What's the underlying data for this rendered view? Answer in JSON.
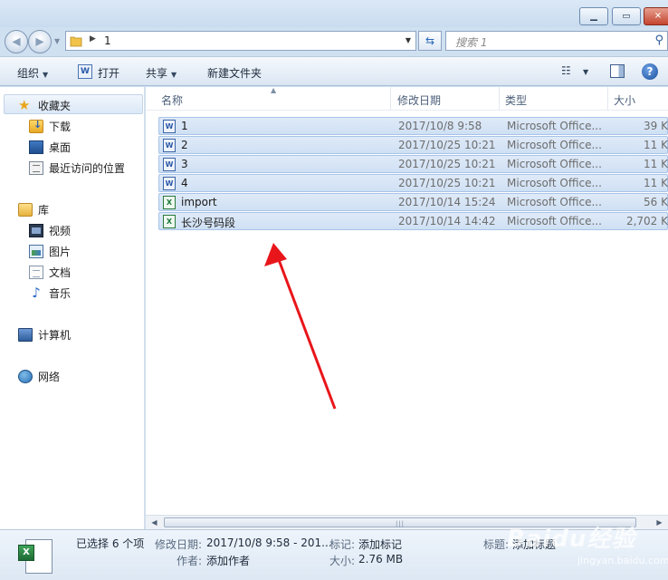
{
  "address": {
    "crumb": "1"
  },
  "search": {
    "placeholder": "搜索 1"
  },
  "toolbar": {
    "organize": "组织",
    "open": "打开",
    "share": "共享",
    "new_folder": "新建文件夹"
  },
  "nav": {
    "favorites": "收藏夹",
    "downloads": "下载",
    "desktop": "桌面",
    "recent": "最近访问的位置",
    "libraries": "库",
    "videos": "视频",
    "pictures": "图片",
    "documents": "文档",
    "music": "音乐",
    "computer": "计算机",
    "network": "网络"
  },
  "columns": {
    "name": "名称",
    "date": "修改日期",
    "type": "类型",
    "size": "大小"
  },
  "files": [
    {
      "name": "1",
      "date": "2017/10/8 9:58",
      "type": "Microsoft Office...",
      "size": "39 K",
      "kind": "word"
    },
    {
      "name": "2",
      "date": "2017/10/25 10:21",
      "type": "Microsoft Office...",
      "size": "11 K",
      "kind": "word"
    },
    {
      "name": "3",
      "date": "2017/10/25 10:21",
      "type": "Microsoft Office...",
      "size": "11 K",
      "kind": "word"
    },
    {
      "name": "4",
      "date": "2017/10/25 10:21",
      "type": "Microsoft Office...",
      "size": "11 K",
      "kind": "word"
    },
    {
      "name": "import",
      "date": "2017/10/14 15:24",
      "type": "Microsoft Office...",
      "size": "56 K",
      "kind": "excel"
    },
    {
      "name": "长沙号码段",
      "date": "2017/10/14 14:42",
      "type": "Microsoft Office...",
      "size": "2,702 K",
      "kind": "excel"
    }
  ],
  "details": {
    "selected": "已选择 6 个项",
    "modified_label": "修改日期:",
    "modified_value": "2017/10/8 9:58 - 201...",
    "tags_label": "标记:",
    "tags_value": "添加标记",
    "title_label": "标题:",
    "title_value": "添加标题",
    "author_label": "作者:",
    "author_value": "添加作者",
    "size_label": "大小:",
    "size_value": "2.76 MB"
  },
  "watermark": {
    "main": "Baidu经验",
    "sub": "jingyan.baidu.com"
  },
  "colors": {
    "selection": "#cfe0f4",
    "arrow": "#e8161b",
    "accent": "#2b58a8"
  }
}
